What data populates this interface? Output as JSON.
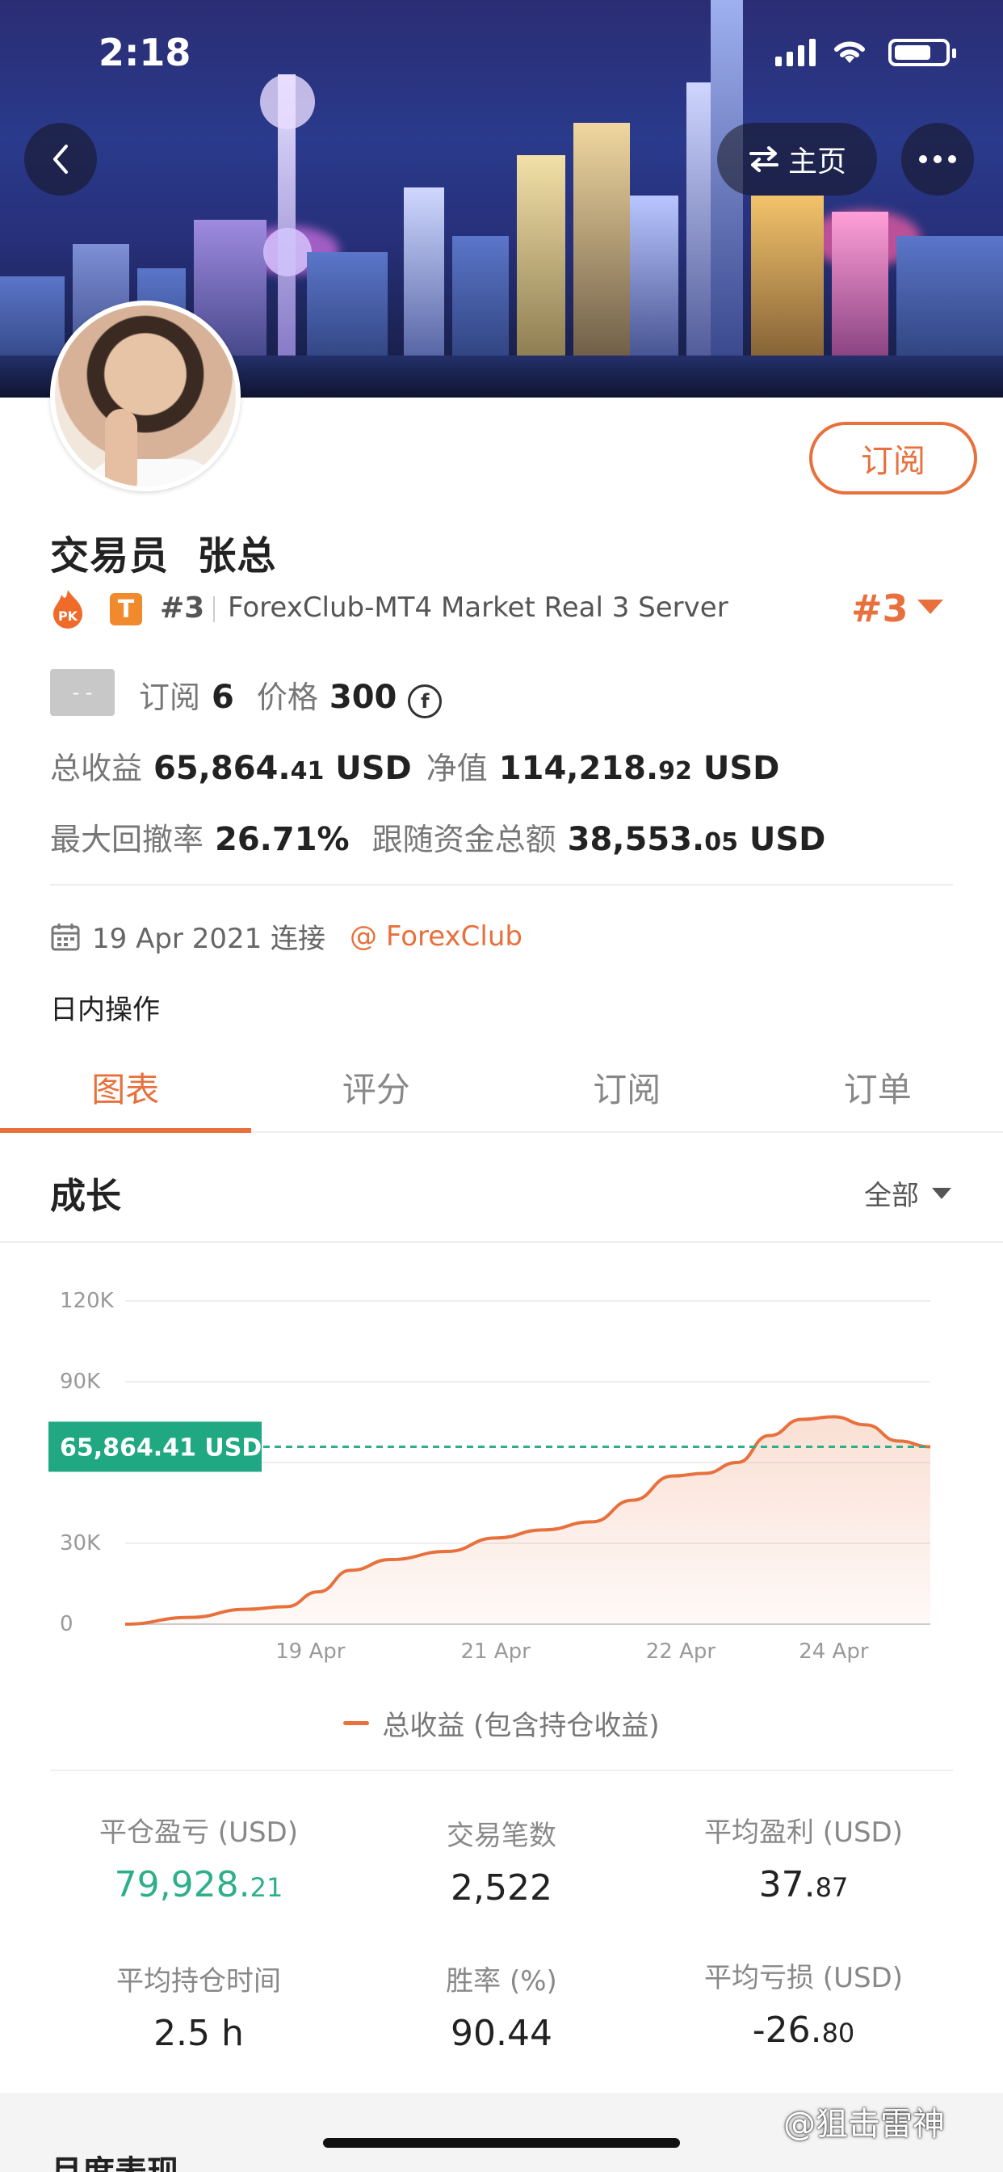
{
  "status_bar": {
    "time": "2:18"
  },
  "header": {
    "home_label": "主页"
  },
  "profile": {
    "subscribe_label": "订阅",
    "name": "交易员  张总",
    "pk_badge": "PK",
    "t_badge": "T",
    "rank_small": "#3",
    "server": "ForexClub-MT4 Market Real 3 Server",
    "rank_big": "#3",
    "tag_gray": "- -",
    "subscriptions_label": "订阅",
    "subscriptions_value": "6",
    "price_label": "价格",
    "price_value": "300",
    "currency_symbol": "f",
    "total_profit_label": "总收益",
    "total_profit_int": "65,864.",
    "total_profit_dec": "41",
    "total_profit_unit": "USD",
    "equity_label": "净值",
    "equity_int": "114,218.",
    "equity_dec": "92",
    "equity_unit": "USD",
    "max_dd_label": "最大回撤率",
    "max_dd_value": "26.71%",
    "follow_funds_label": "跟随资金总额",
    "follow_funds_int": "38,553.",
    "follow_funds_dec": "05",
    "follow_funds_unit": "USD",
    "connect_date": "19 Apr 2021 连接",
    "broker": "@ ForexClub",
    "op_style": "日内操作"
  },
  "tabs": [
    {
      "label": "图表",
      "active": true
    },
    {
      "label": "评分",
      "active": false
    },
    {
      "label": "订阅",
      "active": false
    },
    {
      "label": "订单",
      "active": false
    }
  ],
  "growth": {
    "title": "成长",
    "range": "全部"
  },
  "chart_data": {
    "type": "area",
    "title": "",
    "y_ticks": [
      "0",
      "30K",
      "90K",
      "120K"
    ],
    "ylim": [
      0,
      120000
    ],
    "x_ticks": [
      "19 Apr",
      "21 Apr",
      "22 Apr",
      "24 Apr"
    ],
    "series": [
      {
        "name": "总收益 (包含持仓收益)",
        "color": "#e8703c",
        "points": [
          [
            0,
            0
          ],
          [
            0.08,
            2500
          ],
          [
            0.15,
            5500
          ],
          [
            0.2,
            6500
          ],
          [
            0.24,
            12000
          ],
          [
            0.28,
            20000
          ],
          [
            0.33,
            24000
          ],
          [
            0.4,
            27000
          ],
          [
            0.46,
            32000
          ],
          [
            0.52,
            35000
          ],
          [
            0.58,
            38000
          ],
          [
            0.63,
            46000
          ],
          [
            0.68,
            55000
          ],
          [
            0.72,
            56000
          ],
          [
            0.76,
            60000
          ],
          [
            0.8,
            70000
          ],
          [
            0.84,
            76000
          ],
          [
            0.88,
            77000
          ],
          [
            0.92,
            74000
          ],
          [
            0.96,
            68000
          ],
          [
            1,
            65864.41
          ]
        ]
      }
    ],
    "current_value_label": "65,864.41 USD",
    "current_value": 65864.41,
    "grid": true
  },
  "legend_label": "总收益 (包含持仓收益)",
  "stats": [
    {
      "label": "平仓盈亏 (USD)",
      "int": "79,928.",
      "dec": "21",
      "green": true
    },
    {
      "label": "交易笔数",
      "int": "2,522",
      "dec": ""
    },
    {
      "label": "平均盈利 (USD)",
      "int": "37.",
      "dec": "87"
    },
    {
      "label": "平均持仓时间",
      "int": "2.5 h",
      "dec": ""
    },
    {
      "label": "胜率 (%)",
      "int": "90.44",
      "dec": ""
    },
    {
      "label": "平均亏损 (USD)",
      "int": "-26.",
      "dec": "80"
    }
  ],
  "next_section_title": "月度表现",
  "watermark": "@狙击雷神"
}
